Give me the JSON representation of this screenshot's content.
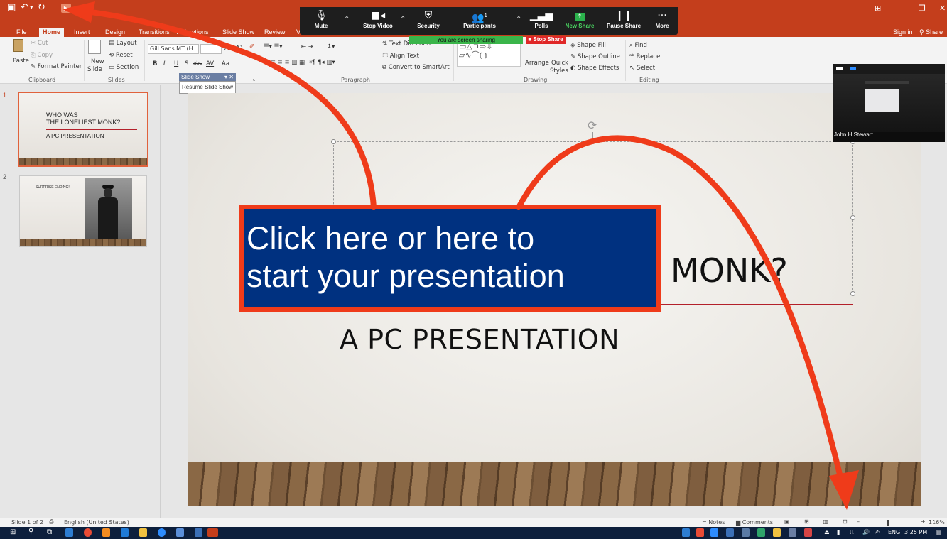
{
  "app": {
    "quick_access": {
      "save_icon": "save-icon",
      "undo_icon": "undo-icon",
      "undo_caret": "▾",
      "redo_icon": "redo-icon"
    },
    "window_controls": {
      "ribbon_display": "⊞",
      "minimize": "–",
      "restore": "❐",
      "close": "✕"
    },
    "account": {
      "sign_in": "Sign in",
      "share": "Share"
    }
  },
  "tabs": [
    "File",
    "Home",
    "Insert",
    "Design",
    "Transitions",
    "Animations",
    "Slide Show",
    "Review",
    "View"
  ],
  "ribbon": {
    "clipboard": {
      "paste": "Paste",
      "cut": "Cut",
      "copy": "Copy",
      "format_painter": "Format Painter",
      "label": "Clipboard"
    },
    "slides": {
      "new_slide_1": "New",
      "new_slide_2": "Slide",
      "layout": "Layout",
      "reset": "Reset",
      "section": "Section",
      "label": "Slides"
    },
    "font": {
      "name": "Gill Sans MT (H",
      "bold": "B",
      "italic": "I",
      "underline": "U",
      "shadow": "S",
      "strike": "abc",
      "spacing": "AV",
      "case": "Aa"
    },
    "paragraph": {
      "text_direction": "Text Direction",
      "align_text": "Align Text",
      "convert_smartart": "Convert to SmartArt",
      "label": "Paragraph"
    },
    "drawing": {
      "arrange": "Arrange",
      "quick_styles_1": "Quick",
      "quick_styles_2": "Styles",
      "shape_fill": "Shape Fill",
      "shape_outline": "Shape Outline",
      "shape_effects": "Shape Effects",
      "label": "Drawing"
    },
    "editing": {
      "find": "Find",
      "replace": "Replace",
      "select": "Select",
      "label": "Editing"
    }
  },
  "zoom_toolbar": {
    "items": [
      {
        "label": "Mute",
        "icon": "microphone-icon"
      },
      {
        "label": "Stop Video",
        "icon": "video-camera-icon"
      },
      {
        "label": "Security",
        "icon": "shield-icon"
      },
      {
        "label": "Participants",
        "icon": "participants-icon",
        "count": "1"
      },
      {
        "label": "Polls",
        "icon": "polls-icon"
      },
      {
        "label": "New Share",
        "icon": "share-screen-icon"
      },
      {
        "label": "Pause Share",
        "icon": "pause-icon"
      },
      {
        "label": "More",
        "icon": "more-icon"
      }
    ],
    "sharing_banner": "You are screen sharing",
    "stop_share": "Stop Share"
  },
  "slideshow_popup": {
    "title": "Slide Show",
    "resume": "Resume Slide Show"
  },
  "thumbnails": [
    {
      "number": "1",
      "line1": "WHO WAS",
      "line2": "THE LONELIEST MONK?",
      "line3": "A PC PRESENTATION"
    },
    {
      "number": "2",
      "heading": "SURPRISE ENDING!"
    }
  ],
  "slide": {
    "title_visible": "MONK?",
    "subtitle": "A PC PRESENTATION"
  },
  "callout": {
    "line1": "Click here or here to",
    "line2": "start your presentation",
    "colors": {
      "fill": "#003180",
      "border": "#ef3b1a",
      "arrow": "#ef3b1a"
    }
  },
  "video": {
    "participant_name": "John H Stewart"
  },
  "status": {
    "slide_info": "Slide 1 of 2",
    "language": "English (United States)",
    "notes": "Notes",
    "comments": "Comments",
    "zoom": "116%"
  },
  "taskbar": {
    "lang": "ENG",
    "time": "3:25 PM"
  }
}
